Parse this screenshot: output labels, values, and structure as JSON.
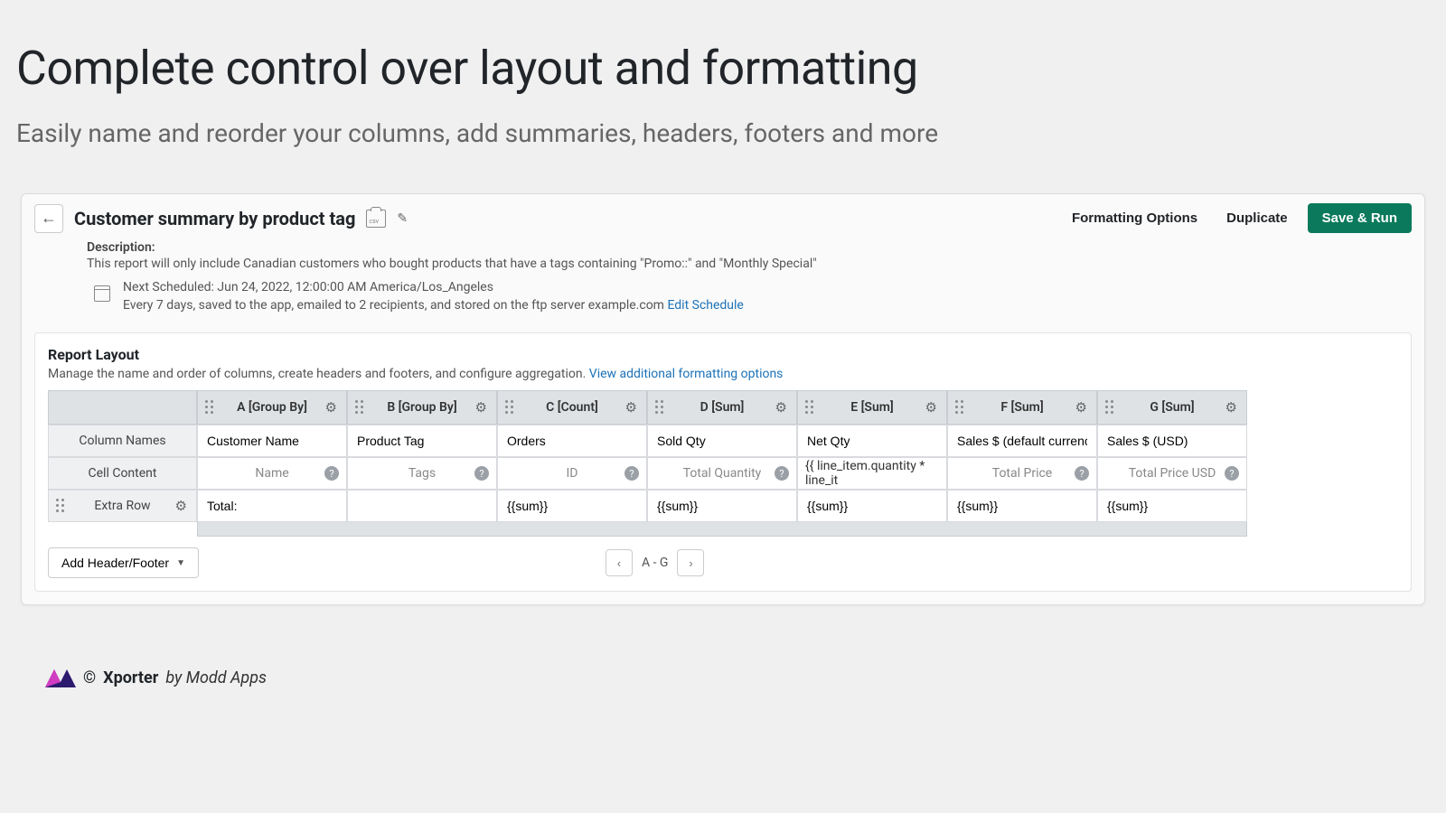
{
  "heading": "Complete control over layout and formatting",
  "subheading": "Easily name and reorder your columns, add summaries, headers, footers and more",
  "report": {
    "title": "Customer summary by product tag",
    "toolbar": {
      "formatting_options": "Formatting Options",
      "duplicate": "Duplicate",
      "save_run": "Save & Run"
    },
    "description_label": "Description:",
    "description_text": "This report will only include Canadian customers who bought products that have a tags containing \"Promo::\" and \"Monthly Special\"",
    "schedule": {
      "next_label": "Next Scheduled: Jun 24, 2022, 12:00:00 AM America/Los_Angeles",
      "detail": "Every 7 days, saved to the app, emailed to 2 recipients, and stored on the ftp server example.com",
      "edit_link": "Edit Schedule"
    }
  },
  "layout": {
    "heading": "Report Layout",
    "subtext": "Manage the name and order of columns, create headers and footers, and configure aggregation.",
    "view_link": "View additional formatting options",
    "row_labels": {
      "column_names": "Column Names",
      "cell_content": "Cell Content",
      "extra_row": "Extra Row"
    },
    "columns": [
      {
        "header": "A [Group By]",
        "name": "Customer Name",
        "content": "Name",
        "extra": "Total:"
      },
      {
        "header": "B [Group By]",
        "name": "Product Tag",
        "content": "Tags",
        "extra": ""
      },
      {
        "header": "C [Count]",
        "name": "Orders",
        "content": "ID",
        "extra": "{{sum}}"
      },
      {
        "header": "D [Sum]",
        "name": "Sold Qty",
        "content": "Total Quantity",
        "extra": "{{sum}}"
      },
      {
        "header": "E [Sum]",
        "name": "Net Qty",
        "content": "{{ line_item.quantity * line_it",
        "extra": "{{sum}}"
      },
      {
        "header": "F [Sum]",
        "name": "Sales $ (default currency)",
        "content": "Total Price",
        "extra": "{{sum}}"
      },
      {
        "header": "G [Sum]",
        "name": "Sales $ (USD)",
        "content": "Total Price USD",
        "extra": "{{sum}}"
      }
    ],
    "add_header_footer": "Add Header/Footer",
    "pager_label": "A - G"
  },
  "brand": {
    "copyright": "©",
    "name": "Xporter",
    "by": "by Modd Apps"
  }
}
